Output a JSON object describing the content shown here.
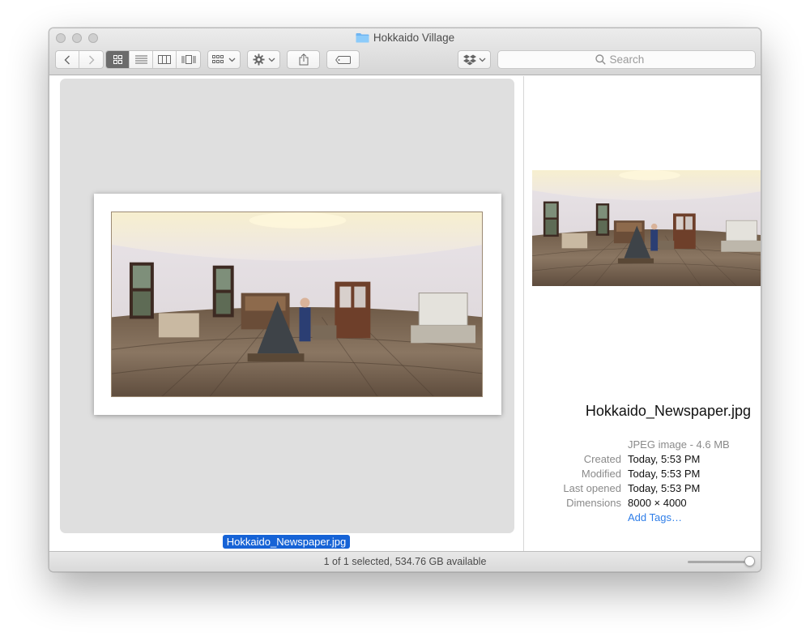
{
  "window": {
    "title": "Hokkaido Village"
  },
  "toolbar": {
    "back_icon": "chevron-left-icon",
    "forward_icon": "chevron-right-icon",
    "view_modes": [
      "icon-view",
      "list-view",
      "column-view",
      "cover-flow-view"
    ],
    "active_view": "icon-view",
    "group_icon": "group-by-icon",
    "action_icon": "gear-icon",
    "share_icon": "share-icon",
    "tag_icon": "tag-icon",
    "dropbox_icon": "dropbox-icon",
    "search_placeholder": "Search"
  },
  "file": {
    "name": "Hokkaido_Newspaper.jpg",
    "kind": "JPEG image - 4.6 MB",
    "info": [
      {
        "label": "Created",
        "value": "Today, 5:53 PM"
      },
      {
        "label": "Modified",
        "value": "Today, 5:53 PM"
      },
      {
        "label": "Last opened",
        "value": "Today, 5:53 PM"
      },
      {
        "label": "Dimensions",
        "value": "8000 × 4000"
      }
    ],
    "add_tags": "Add Tags…"
  },
  "statusbar": {
    "text": "1 of 1 selected, 534.76 GB available",
    "icon_size_level": 0.92
  },
  "colors": {
    "selection": "#1663d6",
    "link": "#2f7ee8",
    "active_segment": "#6b6b6b"
  }
}
